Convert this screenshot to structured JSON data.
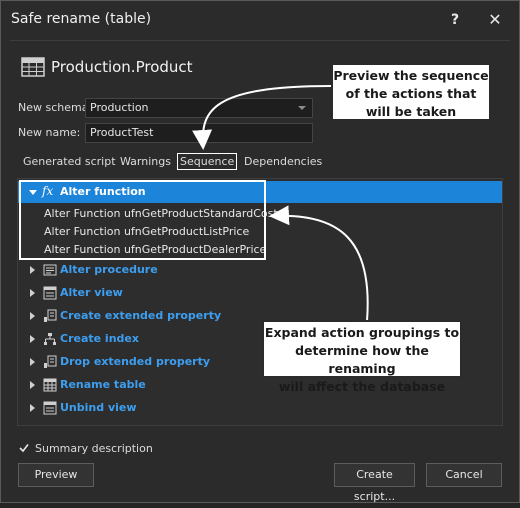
{
  "window": {
    "title": "Safe rename (table)",
    "help_label": "?",
    "close_label": "✕"
  },
  "object": {
    "name": "Production.Product",
    "icon": "table-icon"
  },
  "form": {
    "schema_label": "New schema:",
    "schema_value": "Production",
    "name_label": "New name:",
    "name_value": "ProductTest"
  },
  "tabs": [
    {
      "label": "Generated script"
    },
    {
      "label": "Warnings"
    },
    {
      "label": "Sequence",
      "active": true
    },
    {
      "label": "Dependencies"
    }
  ],
  "tree": {
    "selected_group": {
      "icon": "fx-icon",
      "label": "Alter function",
      "fx_glyph": "fx"
    },
    "children": [
      "Alter Function ufnGetProductStandardCost",
      "Alter Function ufnGetProductListPrice",
      "Alter Function ufnGetProductDealerPrice"
    ],
    "groups": [
      {
        "label": "Alter procedure",
        "icon": "procedure-icon"
      },
      {
        "label": "Alter view",
        "icon": "view-icon"
      },
      {
        "label": "Create extended property",
        "icon": "extended-property-icon"
      },
      {
        "label": "Create index",
        "icon": "index-icon"
      },
      {
        "label": "Drop extended property",
        "icon": "extended-property-icon"
      },
      {
        "label": "Rename table",
        "icon": "table-icon"
      },
      {
        "label": "Unbind view",
        "icon": "view-icon"
      }
    ]
  },
  "callouts": {
    "top": [
      "Preview the sequence",
      "of the actions that",
      "will be taken"
    ],
    "bottom": [
      "Expand action groupings to",
      "determine how the renaming",
      "will affect the database"
    ]
  },
  "summary": {
    "checked": true,
    "label": "Summary description"
  },
  "buttons": {
    "preview": "Preview",
    "create_script": "Create script...",
    "cancel": "Cancel"
  },
  "colors": {
    "accent": "#1c84d9",
    "group_text": "#3d9ef0",
    "background": "#2b2b2b"
  }
}
